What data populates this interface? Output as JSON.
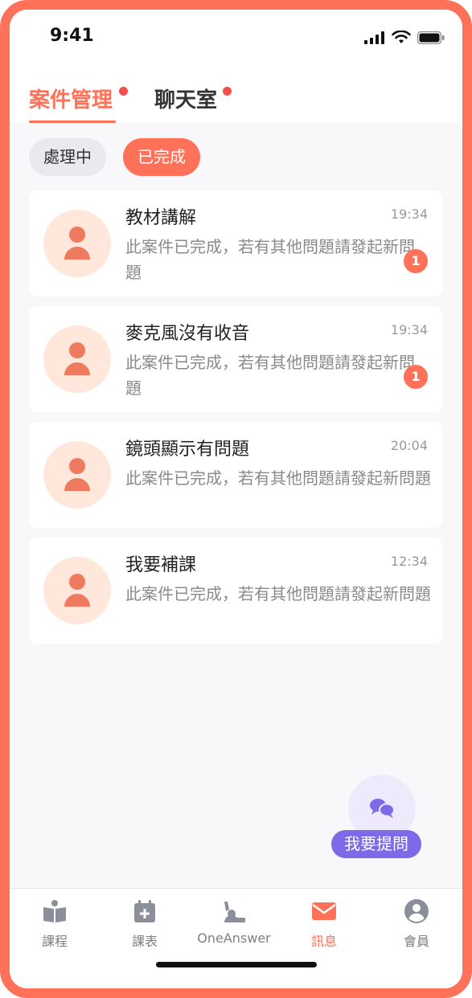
{
  "status_bar": {
    "time": "9:41"
  },
  "tabs": [
    {
      "label": "案件管理",
      "active": true,
      "dot": true
    },
    {
      "label": "聊天室",
      "active": false,
      "dot": true
    }
  ],
  "filters": [
    {
      "label": "處理中",
      "active": false
    },
    {
      "label": "已完成",
      "active": true
    }
  ],
  "cases": [
    {
      "title": "教材講解",
      "time": "19:34",
      "description": "此案件已完成，若有其他問題請發起新問題",
      "unread": "1"
    },
    {
      "title": "麥克風沒有收音",
      "time": "19:34",
      "description": "此案件已完成，若有其他問題請發起新問題",
      "unread": "1"
    },
    {
      "title": "鏡頭顯示有問題",
      "time": "20:04",
      "description": "此案件已完成，若有其他問題請發起新問題"
    },
    {
      "title": "我要補課",
      "time": "12:34",
      "description": "此案件已完成，若有其他問題請發起新問題"
    }
  ],
  "fab": {
    "label": "我要提問",
    "icon": "chat-bubbles-icon"
  },
  "bottom_nav": [
    {
      "label": "課程",
      "icon": "book-icon",
      "active": false
    },
    {
      "label": "課表",
      "icon": "calendar-plus-icon",
      "active": false
    },
    {
      "label": "OneAnswer",
      "icon": "hand-raise-icon",
      "active": false
    },
    {
      "label": "訊息",
      "icon": "envelope-icon",
      "active": true
    },
    {
      "label": "會員",
      "icon": "user-circle-icon",
      "active": false
    }
  ],
  "colors": {
    "accent": "#FF7259",
    "purple": "#7D6AE8",
    "avatar_bg": "#FFE8DB",
    "avatar_fg": "#EF7A5E"
  }
}
